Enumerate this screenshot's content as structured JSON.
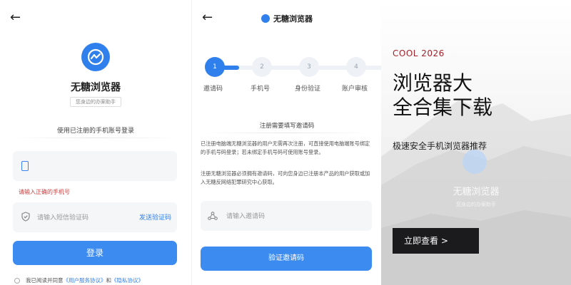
{
  "colors": {
    "brand_blue": "#2f80ed",
    "error_red": "#d23b3b",
    "kicker_red": "#a1222a",
    "cta_dark": "#1b1b1d"
  },
  "login_screen": {
    "app_name": "无糖浏览器",
    "app_tagline": "您身边的办案助手",
    "hint": "使用已注册的手机账号登录",
    "phone_input_value": "",
    "phone_error": "请输入正确的手机号",
    "code_placeholder": "请输入短信验证码",
    "send_code_label": "发送验证码",
    "login_button": "登录",
    "agree_prefix": "我已阅读并同意",
    "user_agreement": "《用户服务协议》",
    "and": "和",
    "privacy_policy": "《隐私协议》"
  },
  "invite_screen": {
    "title": "无糖浏览器",
    "steps": [
      {
        "num": "1",
        "label": "邀请码"
      },
      {
        "num": "2",
        "label": "手机号"
      },
      {
        "num": "3",
        "label": "身份验证"
      },
      {
        "num": "4",
        "label": "账户审核"
      }
    ],
    "hint": "注册需要填写邀请码",
    "para1": "已注册电脑端无糖浏览器的用户无需再次注册，可直接使用电脑端账号绑定的手机号码登录；若未绑定手机号码可使用账号登录。",
    "para2": "注册无糖浏览器必须拥有邀请码，可向您身边已注册本产品的用户获取或加入无糖反网络犯罪研究中心获取。",
    "invite_placeholder": "请输入邀请码",
    "verify_button": "验证邀请码"
  },
  "promo": {
    "kicker": "COOL 2026",
    "title_line1": "浏览器大",
    "title_line2": "全合集下载",
    "subtitle": "极速安全手机浏览器推荐",
    "cta": "立即查看 >",
    "ghost_app_name": "无糖浏览器",
    "ghost_tagline": "您身边的办案助手"
  }
}
